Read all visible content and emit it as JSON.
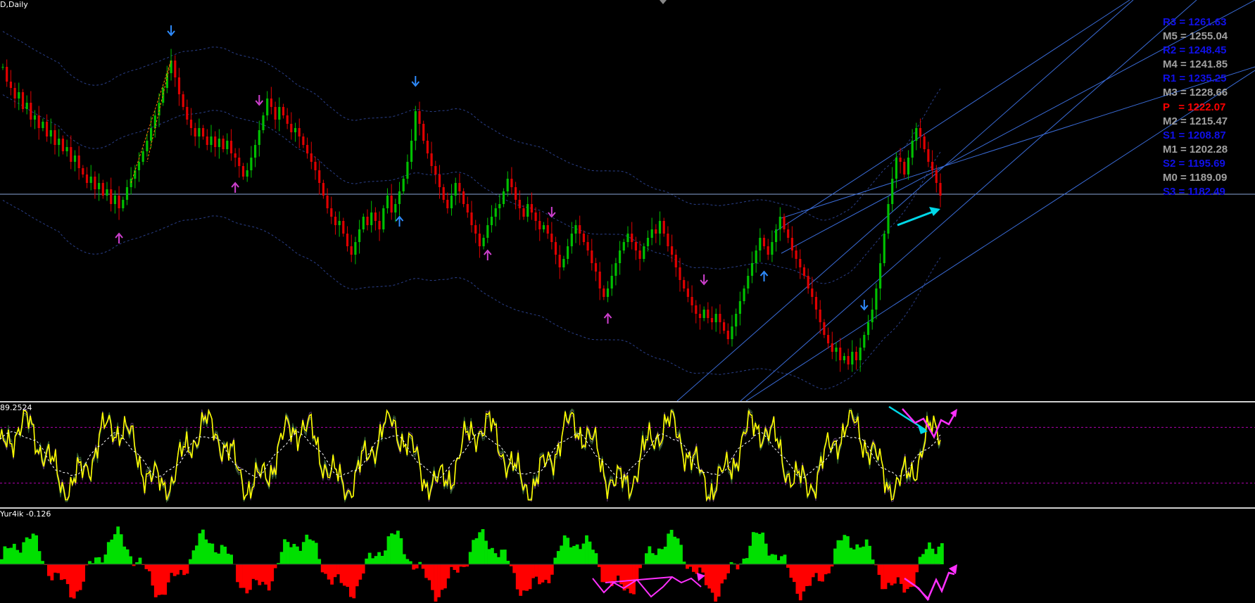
{
  "colors": {
    "background": "#000000",
    "bull": "#00c000",
    "bear": "#e00000",
    "channel": "#3a6bd6",
    "envelope": "#2a3f8a",
    "oscillator": "#ffff00",
    "level_line": "#b000b0",
    "annotation_cyan": "#00d8e8",
    "annotation_magenta": "#ff30ff",
    "pivot_blue": "#1010e8",
    "pivot_gray": "#a0a0a0",
    "pivot_red": "#ff0000"
  },
  "main_pane": {
    "label": "D,Daily",
    "pivots": [
      {
        "text": "R3 = 1261.63",
        "color": "#1010e8"
      },
      {
        "text": "M5 = 1255.04",
        "color": "#a0a0a0"
      },
      {
        "text": "R2 = 1248.45",
        "color": "#1010e8"
      },
      {
        "text": "M4 = 1241.85",
        "color": "#a0a0a0"
      },
      {
        "text": "R1 = 1235.25",
        "color": "#1010e8"
      },
      {
        "text": "M3 = 1228.66",
        "color": "#a0a0a0"
      },
      {
        "text": "P   = 1222.07",
        "color": "#ff0000"
      },
      {
        "text": "M2 = 1215.47",
        "color": "#a0a0a0"
      },
      {
        "text": "S1 = 1208.87",
        "color": "#1010e8"
      },
      {
        "text": "M1 = 1202.28",
        "color": "#a0a0a0"
      },
      {
        "text": "S2 = 1195.69",
        "color": "#1010e8"
      },
      {
        "text": "M0 = 1189.09",
        "color": "#a0a0a0"
      },
      {
        "text": "S3 = 1182.49",
        "color": "#1010e8"
      }
    ]
  },
  "oscillator_pane": {
    "label": "89.2524"
  },
  "histogram_pane": {
    "label": "Yur4ik -0.126"
  },
  "chart_data": [
    {
      "type": "candlestick",
      "pane": "main",
      "close_path": [
        1255,
        1248,
        1245,
        1240,
        1243,
        1235,
        1238,
        1230,
        1232,
        1226,
        1229,
        1222,
        1225,
        1218,
        1221,
        1215,
        1217,
        1210,
        1213,
        1207,
        1204,
        1200,
        1203,
        1197,
        1200,
        1194,
        1197,
        1190,
        1194,
        1188,
        1192,
        1198,
        1202,
        1206,
        1210,
        1215,
        1220,
        1226,
        1232,
        1238,
        1245,
        1252,
        1258,
        1250,
        1242,
        1236,
        1230,
        1226,
        1222,
        1226,
        1222,
        1218,
        1222,
        1217,
        1221,
        1216,
        1220,
        1214,
        1212,
        1208,
        1203,
        1206,
        1212,
        1218,
        1225,
        1232,
        1240,
        1236,
        1230,
        1236,
        1232,
        1228,
        1224,
        1226,
        1222,
        1218,
        1214,
        1210,
        1206,
        1200,
        1194,
        1188,
        1184,
        1180,
        1182,
        1176,
        1170,
        1166,
        1172,
        1178,
        1184,
        1180,
        1186,
        1182,
        1178,
        1188,
        1194,
        1186,
        1190,
        1196,
        1202,
        1210,
        1220,
        1234,
        1228,
        1220,
        1214,
        1208,
        1204,
        1198,
        1192,
        1188,
        1194,
        1200,
        1196,
        1190,
        1186,
        1180,
        1176,
        1170,
        1174,
        1180,
        1184,
        1188,
        1190,
        1196,
        1202,
        1198,
        1192,
        1188,
        1184,
        1190,
        1186,
        1182,
        1178,
        1180,
        1176,
        1172,
        1166,
        1160,
        1164,
        1170,
        1176,
        1180,
        1176,
        1172,
        1168,
        1162,
        1158,
        1150,
        1146,
        1150,
        1156,
        1162,
        1168,
        1172,
        1176,
        1172,
        1168,
        1164,
        1170,
        1174,
        1178,
        1176,
        1182,
        1176,
        1170,
        1166,
        1160,
        1154,
        1150,
        1146,
        1142,
        1138,
        1136,
        1140,
        1136,
        1134,
        1138,
        1134,
        1130,
        1126,
        1132,
        1138,
        1144,
        1150,
        1156,
        1162,
        1168,
        1174,
        1170,
        1166,
        1172,
        1178,
        1184,
        1178,
        1174,
        1168,
        1164,
        1160,
        1156,
        1150,
        1146,
        1140,
        1134,
        1128,
        1124,
        1120,
        1122,
        1116,
        1118,
        1114,
        1120,
        1116,
        1122,
        1128,
        1134,
        1140,
        1150,
        1162,
        1176,
        1190,
        1202,
        1212,
        1210,
        1204,
        1212,
        1220,
        1226,
        1222,
        1216,
        1210,
        1206,
        1200,
        1194
      ],
      "arrows": [
        {
          "type": "down",
          "color": "#2f8cff",
          "bar": 42
        },
        {
          "type": "up",
          "color": "#d040d0",
          "bar": 29
        },
        {
          "type": "down",
          "color": "#d040d0",
          "bar": 64
        },
        {
          "type": "up",
          "color": "#d040d0",
          "bar": 58
        },
        {
          "type": "up",
          "color": "#2f8cff",
          "bar": 99
        },
        {
          "type": "down",
          "color": "#2f8cff",
          "bar": 103
        },
        {
          "type": "up",
          "color": "#d040d0",
          "bar": 121
        },
        {
          "type": "down",
          "color": "#d040d0",
          "bar": 137
        },
        {
          "type": "up",
          "color": "#d040d0",
          "bar": 151
        },
        {
          "type": "down",
          "color": "#d040d0",
          "bar": 175
        },
        {
          "type": "up",
          "color": "#2f8cff",
          "bar": 190
        },
        {
          "type": "down",
          "color": "#2f8cff",
          "bar": 215
        }
      ],
      "horizontal_line": 1222.07
    },
    {
      "type": "line",
      "pane": "oscillator",
      "levels": [
        80,
        20
      ],
      "ylim": [
        0,
        100
      ]
    },
    {
      "type": "bar",
      "pane": "histogram",
      "ylim": [
        -1,
        1
      ]
    }
  ]
}
